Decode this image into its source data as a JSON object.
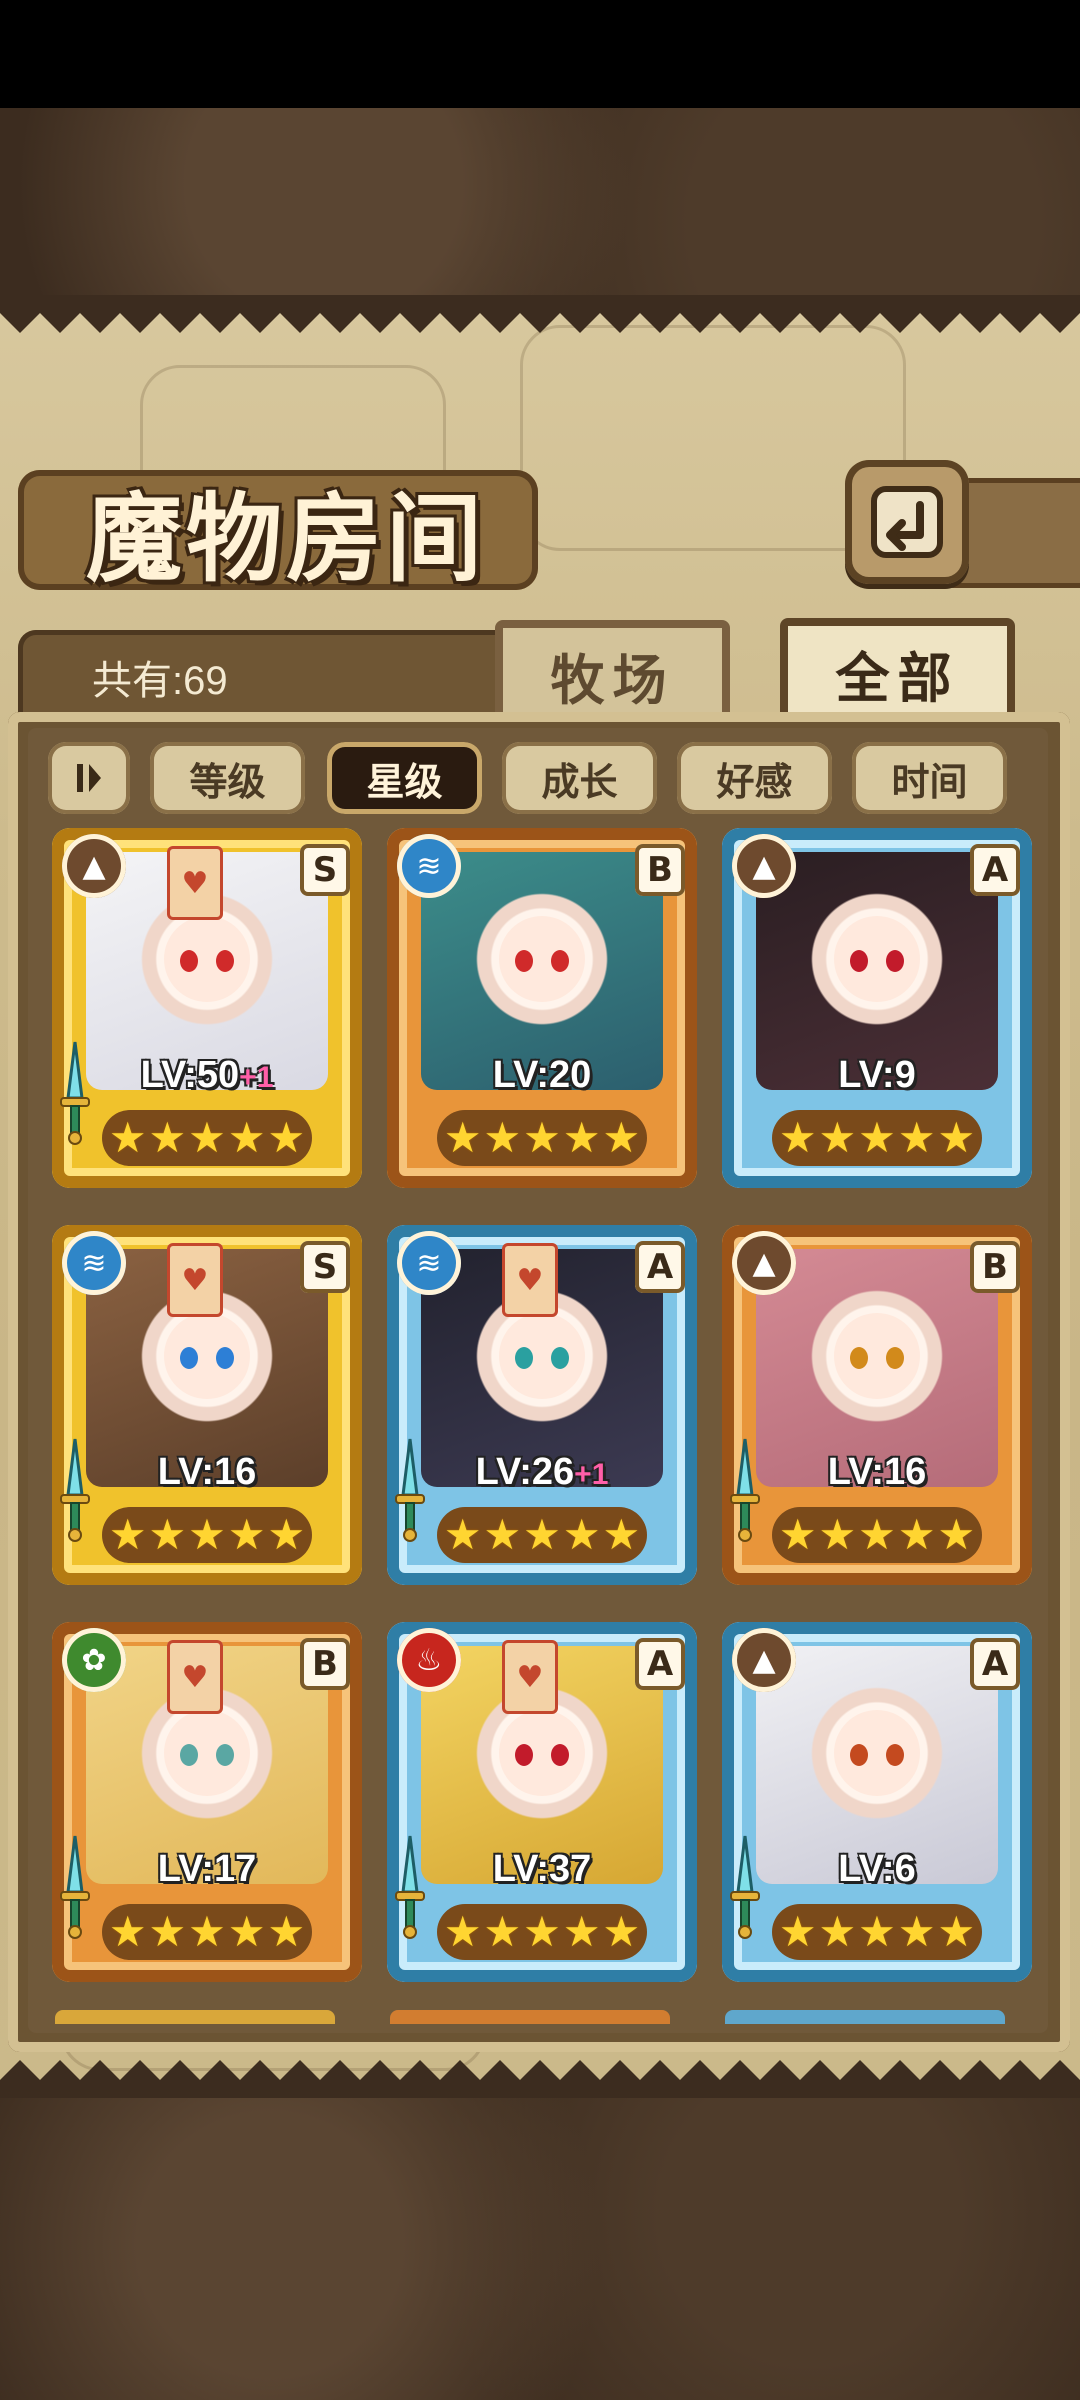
{
  "title": "魔物房间",
  "count_label": "共有:69",
  "tabs": {
    "ranch": "牧场",
    "all": "全部",
    "active": "all"
  },
  "filters": {
    "sort_icon": "sort-toggle-icon",
    "items": [
      "等级",
      "星级",
      "成长",
      "好感",
      "时间"
    ],
    "active": "星级"
  },
  "back_icon": "return-arrow-icon",
  "monsters": [
    {
      "level": "LV:50",
      "bonus": "+1",
      "rank": "S",
      "element": "earth",
      "frame": "gold",
      "stars": 5,
      "talisman": true,
      "sword": true
    },
    {
      "level": "LV:20",
      "bonus": "",
      "rank": "B",
      "element": "water",
      "frame": "orange",
      "stars": 5,
      "talisman": false,
      "sword": false
    },
    {
      "level": "LV:9",
      "bonus": "",
      "rank": "A",
      "element": "earth",
      "frame": "blue",
      "stars": 5,
      "talisman": false,
      "sword": false
    },
    {
      "level": "LV:16",
      "bonus": "",
      "rank": "S",
      "element": "water",
      "frame": "gold",
      "stars": 5,
      "talisman": true,
      "sword": true
    },
    {
      "level": "LV:26",
      "bonus": "+1",
      "rank": "A",
      "element": "water",
      "frame": "blue",
      "stars": 5,
      "talisman": true,
      "sword": true
    },
    {
      "level": "LV:16",
      "bonus": "",
      "rank": "B",
      "element": "earth",
      "frame": "orange",
      "stars": 5,
      "talisman": false,
      "sword": true
    },
    {
      "level": "LV:17",
      "bonus": "",
      "rank": "B",
      "element": "wood",
      "frame": "orange",
      "stars": 5,
      "talisman": true,
      "sword": true
    },
    {
      "level": "LV:37",
      "bonus": "",
      "rank": "A",
      "element": "fire",
      "frame": "blue",
      "stars": 5,
      "talisman": true,
      "sword": true
    },
    {
      "level": "LV:6",
      "bonus": "",
      "rank": "A",
      "element": "earth",
      "frame": "blue",
      "stars": 5,
      "talisman": false,
      "sword": true
    }
  ],
  "element_colors": {
    "earth": "#6e4a2e",
    "water": "#2f86c8",
    "wood": "#3f8a2e",
    "fire": "#c7261e"
  },
  "element_glyphs": {
    "earth": "▲",
    "water": "≋",
    "wood": "✿",
    "fire": "♨"
  },
  "hair_colors": [
    [
      "#f4f4f6",
      "#d9d9e3"
    ],
    [
      "#3c8d8a",
      "#2c5f6e"
    ],
    [
      "#2a1e22",
      "#4b2f36"
    ],
    [
      "#8a6141",
      "#5c3f2a"
    ],
    [
      "#22222e",
      "#3c3a52"
    ],
    [
      "#d48a94",
      "#b56c79"
    ],
    [
      "#f1d487",
      "#e2b85a"
    ],
    [
      "#f3d462",
      "#d6a733"
    ],
    [
      "#f1f1f4",
      "#c9c9d6"
    ]
  ],
  "eye_colors": [
    "#d02a2a",
    "#d02a2a",
    "#c21b2b",
    "#2d7fd6",
    "#2aa0a0",
    "#d28a1b",
    "#5aa7a3",
    "#c21b2b",
    "#c44a1f"
  ]
}
